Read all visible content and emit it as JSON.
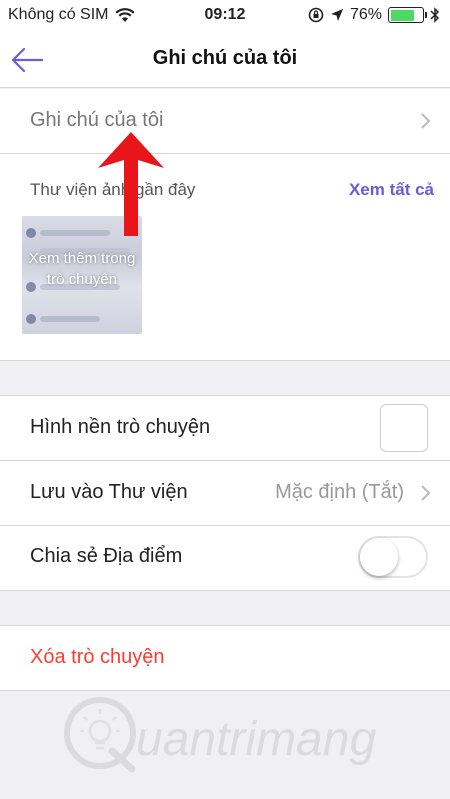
{
  "status_bar": {
    "carrier": "Không có SIM",
    "time": "09:12",
    "battery": "76%",
    "battery_level": 0.76
  },
  "nav": {
    "title": "Ghi chú của tôi"
  },
  "rows": {
    "notes": "Ghi chú của tôi",
    "background": "Hình nền trò chuyện",
    "save_library": "Lưu vào Thư viện",
    "save_library_value": "Mặc định (Tắt)",
    "share_location": "Chia sẻ Địa điểm",
    "delete_chat": "Xóa trò chuyện"
  },
  "gallery": {
    "title": "Thư viện ảnh gần đây",
    "see_all": "Xem tất cả",
    "thumb_overlay": "Xem thêm trong trò chuyện"
  },
  "toggles": {
    "share_location": false
  },
  "watermark": {
    "logo_text": "uantrimang"
  },
  "colors": {
    "accent": "#6f5bd7",
    "danger": "#ff3b30",
    "arrow": "#e8161b",
    "battery": "#4cd964"
  },
  "icons": [
    "wifi-icon",
    "orientation-lock-icon",
    "location-icon",
    "bluetooth-icon",
    "battery-icon",
    "back-arrow-icon",
    "chevron-right-icon",
    "annotation-arrow"
  ]
}
